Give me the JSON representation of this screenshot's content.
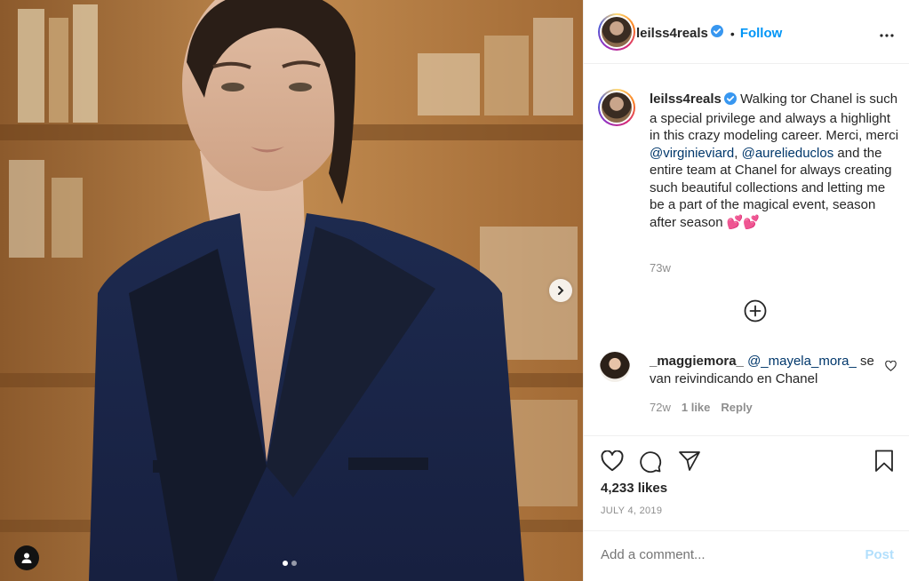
{
  "post": {
    "username": "leilss4reals",
    "follow_label": "Follow",
    "separator": "•",
    "more_icon": "more-horizontal-icon",
    "caption": {
      "text_before": "Walking tor Chanel is such a special privilege and always a highlight in this crazy modeling career. Merci, merci ",
      "mention1": "@virginieviard",
      "comma": ",",
      "mention2": "@aurelieduclos",
      "text_after": " and the entire team at Chanel for always creating such beautiful collections and letting me be a part of the magical event, season after season 💕💕",
      "time": "73w"
    },
    "comment": {
      "username": "_maggiemora_",
      "mention": "@_mayela_mora_",
      "text": "se van reivindicando en Chanel",
      "time": "72w",
      "likes": "1 like",
      "reply_label": "Reply"
    },
    "likes": "4,233 likes",
    "date": "JULY 4, 2019",
    "add_comment_placeholder": "Add a comment...",
    "post_label": "Post",
    "carousel": {
      "total": 2,
      "active_index": 0
    }
  },
  "colors": {
    "accent": "#0095f6",
    "mention": "#00376b",
    "muted": "#8e8e8e",
    "post_disabled": "#b2dffc",
    "verified": "#3897f0"
  }
}
